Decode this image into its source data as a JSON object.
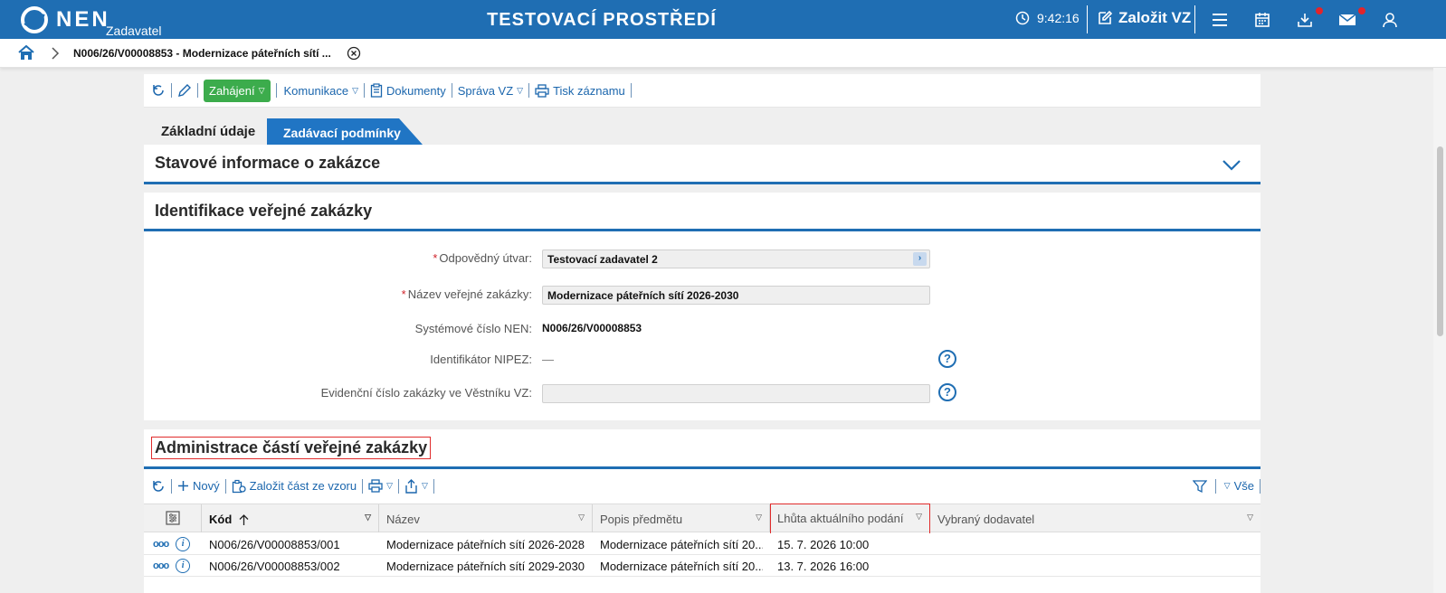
{
  "header": {
    "logo_text": "NEN",
    "logo_sub": "Zadavatel",
    "env_title": "TESTOVACÍ PROSTŘEDÍ",
    "time": "9:42:16",
    "create_label": "Založit VZ",
    "icons": [
      "clock-icon",
      "edit-icon",
      "menu-icon",
      "calendar-icon",
      "download-icon",
      "mail-icon",
      "user-icon"
    ],
    "brand_color": "#1f6eb3",
    "notification_color": "#e3242b"
  },
  "breadcrumb": {
    "title": "N006/26/V00008853 - Modernizace páteřních sítí ..."
  },
  "toolbar": {
    "zahajeni": "Zahájení",
    "komunikace": "Komunikace",
    "dokumenty": "Dokumenty",
    "sprava": "Správa VZ",
    "tisk": "Tisk záznamu"
  },
  "tabs": {
    "basic": "Základní údaje",
    "conditions": "Zadávací podmínky"
  },
  "sections": {
    "status": "Stavové informace o zakázce",
    "identification": "Identifikace veřejné zakázky",
    "administration": "Administrace částí veřejné zakázky"
  },
  "form": {
    "unit_label": "Odpovědný útvar:",
    "unit_value": "Testovací zadavatel 2",
    "name_label": "Název veřejné zakázky:",
    "name_value": "Modernizace páteřních sítí 2026-2030",
    "system_label": "Systémové číslo NEN:",
    "system_value": "N006/26/V00008853",
    "nipez_label": "Identifikátor NIPEZ:",
    "nipez_value": "—",
    "vestnik_label": "Evidenční číslo zakázky ve Věstníku VZ:",
    "vestnik_value": "",
    "help_glyph": "?"
  },
  "table_toolbar": {
    "new": "Nový",
    "from_template": "Založit část ze vzoru",
    "all": "Vše"
  },
  "table": {
    "columns": [
      "Kód",
      "Název",
      "Popis předmětu",
      "Lhůta aktuálního podání",
      "Vybraný dodavatel"
    ],
    "rows": [
      {
        "kod": "N006/26/V00008853/001",
        "nazev": "Modernizace páteřních sítí 2026-2028",
        "popis": "Modernizace páteřních sítí 20...",
        "lhuta": "15. 7. 2026 10:00",
        "dodavatel": ""
      },
      {
        "kod": "N006/26/V00008853/002",
        "nazev": "Modernizace páteřních sítí 2029-2030",
        "popis": "Modernizace páteřních sítí 20...",
        "lhuta": "13. 7. 2026 16:00",
        "dodavatel": ""
      }
    ]
  }
}
